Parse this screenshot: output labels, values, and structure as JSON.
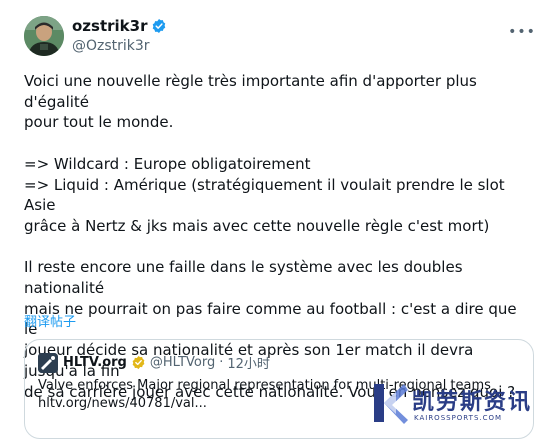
{
  "author": {
    "display_name": "ozstrik3r",
    "handle": "@Ozstrik3r",
    "avatar_icon": "profile-avatar",
    "verified_icon": "verified-badge-icon"
  },
  "more_icon": "more-options-icon",
  "tweet": {
    "text": "Voici une nouvelle règle très importante afin d'apporter plus d'égalité\npour tout le monde.\n\n=> Wildcard : Europe obligatoirement\n=> Liquid : Amérique (stratégiquement il voulait prendre le slot Asie\ngrâce à Nertz & jks mais avec cette nouvelle règle c'est mort)\n\nIl reste encore une faille dans le système avec les doubles nationalité\nmais ne pourrait on pas faire comme au football : c'est a dire que le\njoueur décide sa nationalité et après son 1er match il devra jusqu'a la fin\nde sa carrière jouer avec cette nationalité. Vous en pensez quoi ?",
    "translate_label": "翻译帖子"
  },
  "quote": {
    "name": "HLTV.org",
    "handle": "@HLTVorg",
    "separator": "·",
    "time": "12小时",
    "line1": "Valve enforces Major regional representation for multi-regional teams",
    "line2": "hltv.org/news/40781/val..."
  },
  "watermark": {
    "title": "凯劳斯资讯",
    "subtitle": "KAIROSSPORTS.COM"
  },
  "colors": {
    "accent": "#1d9bf0",
    "text": "#0f1419",
    "muted": "#536471",
    "border": "#cfd9de",
    "watermark": "#2a3d86"
  }
}
